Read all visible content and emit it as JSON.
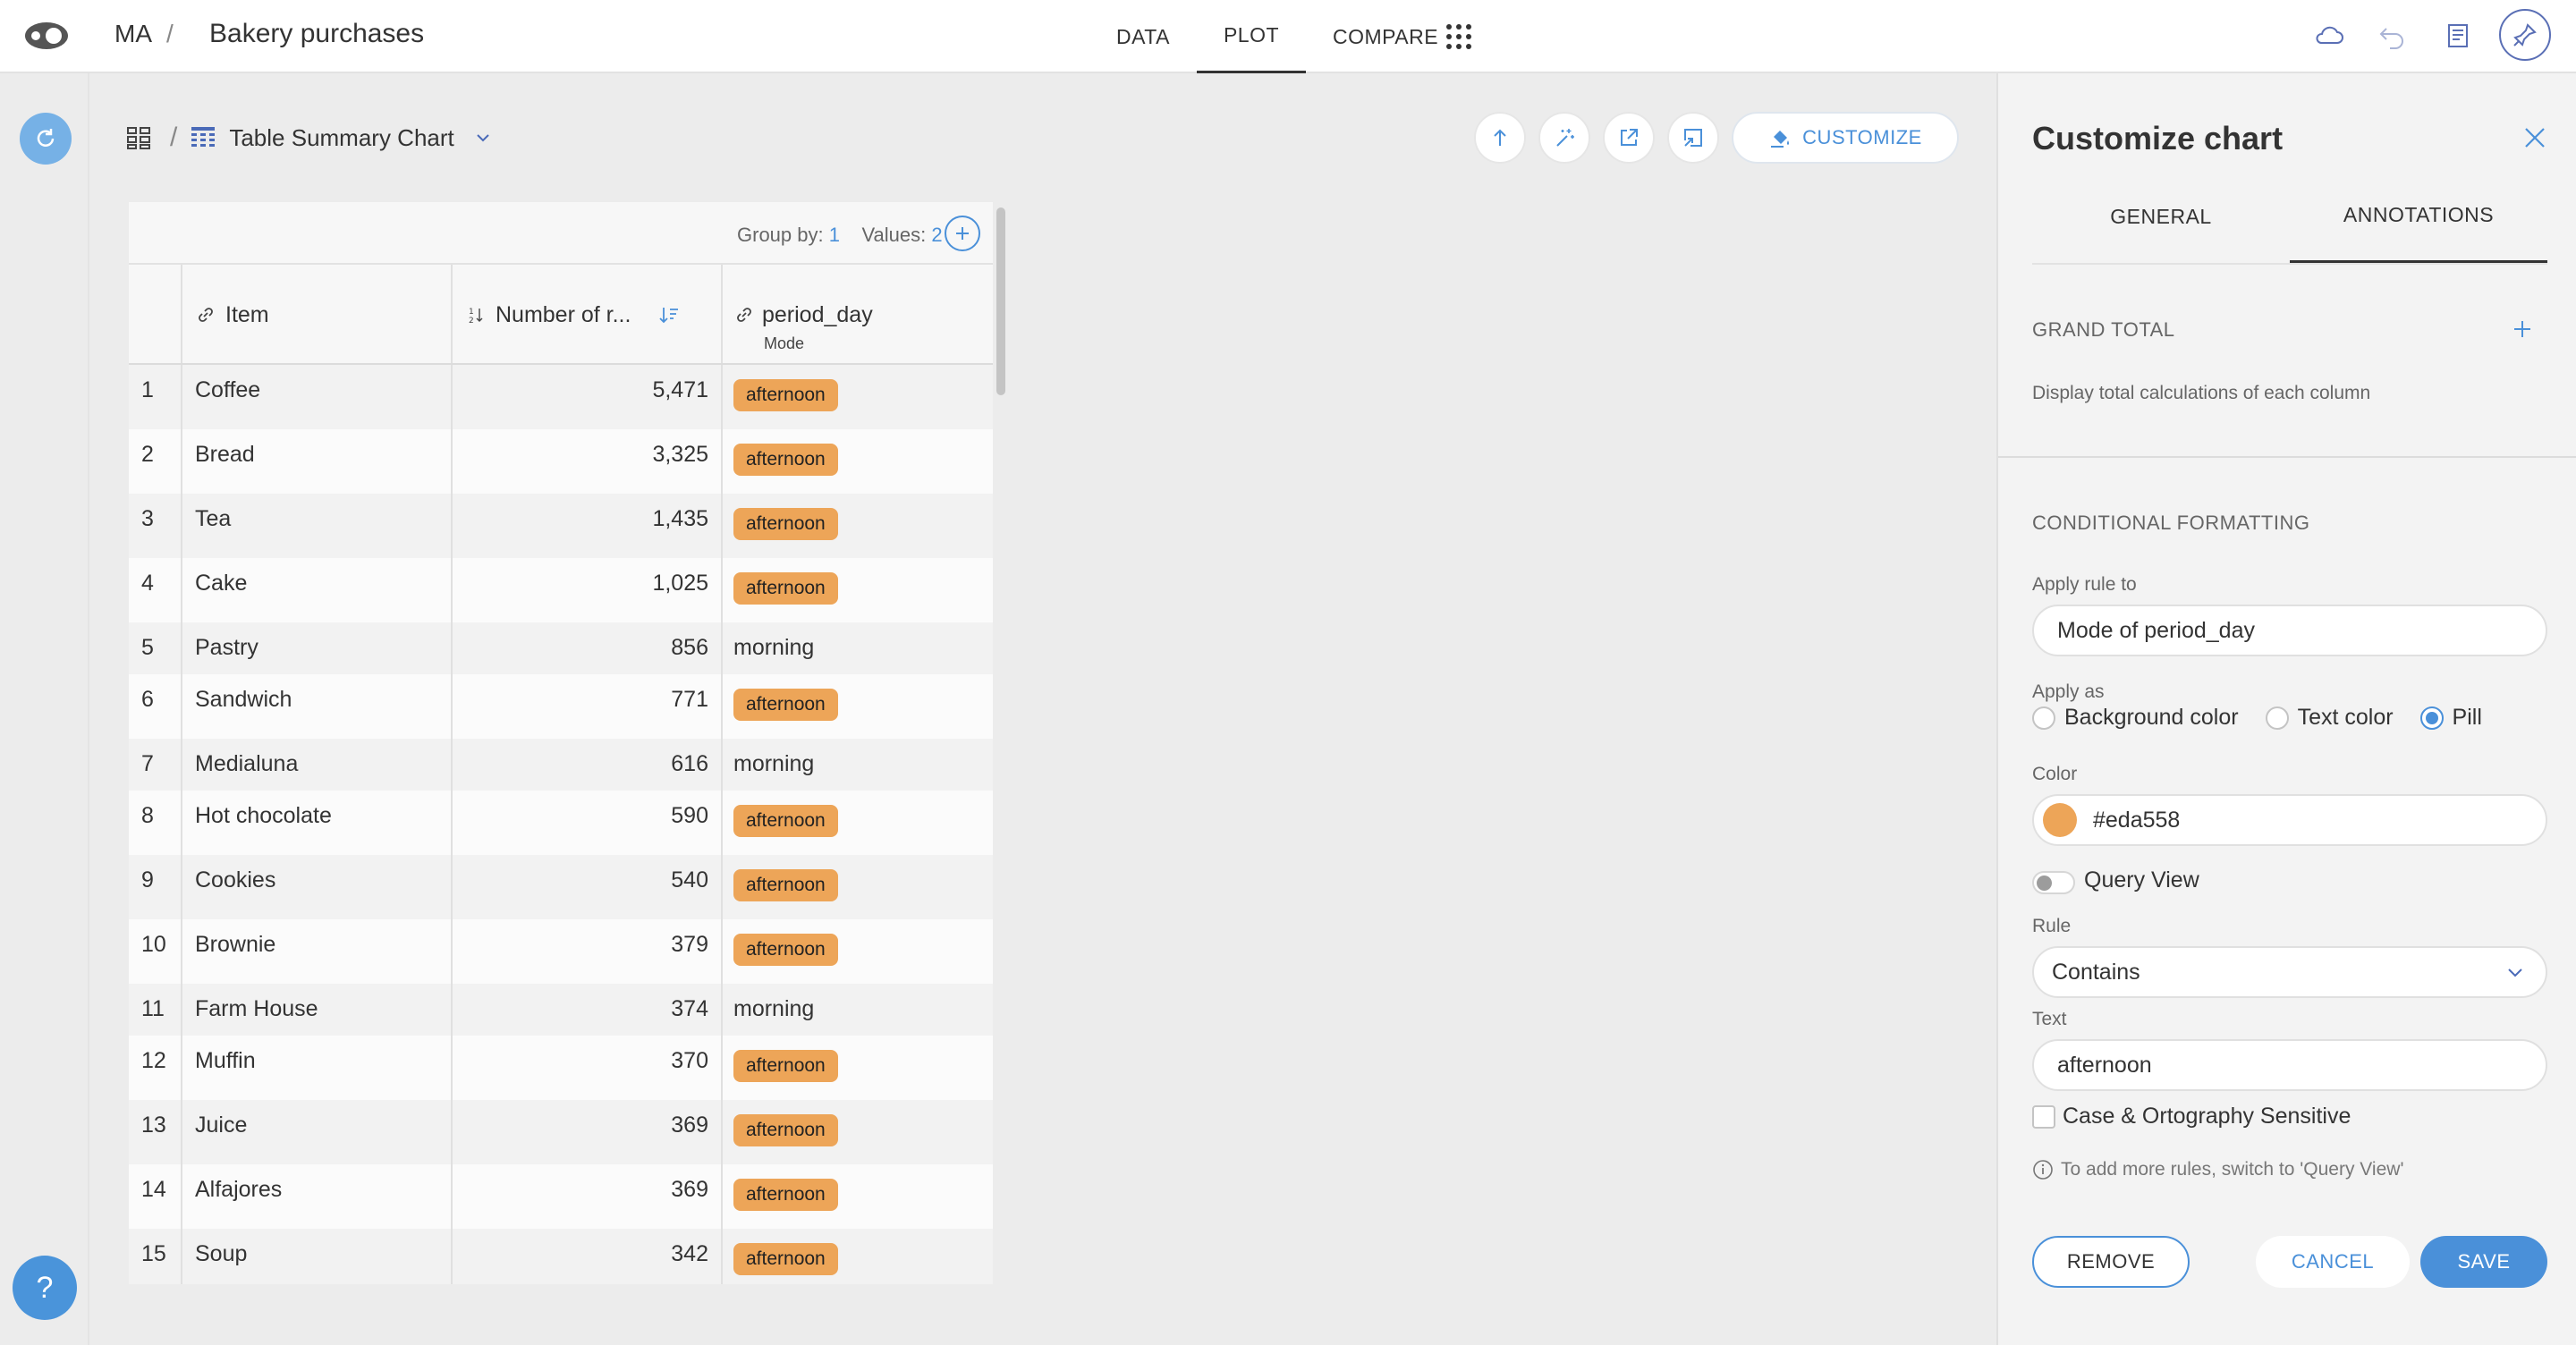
{
  "app": {
    "workspace": "MA",
    "project_title": "Bakery purchases"
  },
  "nav": {
    "tabs": [
      {
        "label": "DATA"
      },
      {
        "label": "PLOT"
      },
      {
        "label": "COMPARE"
      }
    ],
    "active": "PLOT"
  },
  "chart": {
    "title": "Table Summary Chart",
    "customize_label": "CUSTOMIZE"
  },
  "table": {
    "group_by_label": "Group by:",
    "group_by_value": "1",
    "values_label": "Values:",
    "values_value": "2",
    "columns": [
      {
        "label": "Item"
      },
      {
        "label": "Number of r..."
      },
      {
        "label": "period_day",
        "sub": "Mode"
      }
    ],
    "rows": [
      {
        "n": "1",
        "item": "Coffee",
        "count": "5,471",
        "period": "afternoon",
        "pill": true
      },
      {
        "n": "2",
        "item": "Bread",
        "count": "3,325",
        "period": "afternoon",
        "pill": true
      },
      {
        "n": "3",
        "item": "Tea",
        "count": "1,435",
        "period": "afternoon",
        "pill": true
      },
      {
        "n": "4",
        "item": "Cake",
        "count": "1,025",
        "period": "afternoon",
        "pill": true
      },
      {
        "n": "5",
        "item": "Pastry",
        "count": "856",
        "period": "morning",
        "pill": false
      },
      {
        "n": "6",
        "item": "Sandwich",
        "count": "771",
        "period": "afternoon",
        "pill": true
      },
      {
        "n": "7",
        "item": "Medialuna",
        "count": "616",
        "period": "morning",
        "pill": false
      },
      {
        "n": "8",
        "item": "Hot chocolate",
        "count": "590",
        "period": "afternoon",
        "pill": true
      },
      {
        "n": "9",
        "item": "Cookies",
        "count": "540",
        "period": "afternoon",
        "pill": true
      },
      {
        "n": "10",
        "item": "Brownie",
        "count": "379",
        "period": "afternoon",
        "pill": true
      },
      {
        "n": "11",
        "item": "Farm House",
        "count": "374",
        "period": "morning",
        "pill": false
      },
      {
        "n": "12",
        "item": "Muffin",
        "count": "370",
        "period": "afternoon",
        "pill": true
      },
      {
        "n": "13",
        "item": "Juice",
        "count": "369",
        "period": "afternoon",
        "pill": true
      },
      {
        "n": "14",
        "item": "Alfajores",
        "count": "369",
        "period": "afternoon",
        "pill": true
      },
      {
        "n": "15",
        "item": "Soup",
        "count": "342",
        "period": "afternoon",
        "pill": true
      }
    ]
  },
  "panel": {
    "title": "Customize chart",
    "tabs": [
      "GENERAL",
      "ANNOTATIONS"
    ],
    "active_tab": "ANNOTATIONS",
    "grand_total": {
      "label": "GRAND TOTAL",
      "description": "Display total calculations of each column"
    },
    "conditional": {
      "label": "CONDITIONAL FORMATTING",
      "apply_rule_to_label": "Apply rule to",
      "apply_rule_to_value": "Mode of period_day",
      "apply_as_label": "Apply as",
      "apply_as_options": [
        "Background color",
        "Text color",
        "Pill"
      ],
      "apply_as_selected": "Pill",
      "color_label": "Color",
      "color_value": "#eda558",
      "query_view_label": "Query View",
      "query_view_on": false,
      "rule_label": "Rule",
      "rule_value": "Contains",
      "text_label": "Text",
      "text_value": "afternoon",
      "case_sensitive_label": "Case & Ortography Sensitive",
      "case_sensitive_checked": false,
      "info_text": "To add more rules, switch to 'Query View'"
    },
    "buttons": {
      "remove": "REMOVE",
      "cancel": "CANCEL",
      "save": "SAVE"
    }
  },
  "help_label": "?",
  "icons": {
    "accent": "#4a90d9",
    "pill_color": "#eda558"
  }
}
